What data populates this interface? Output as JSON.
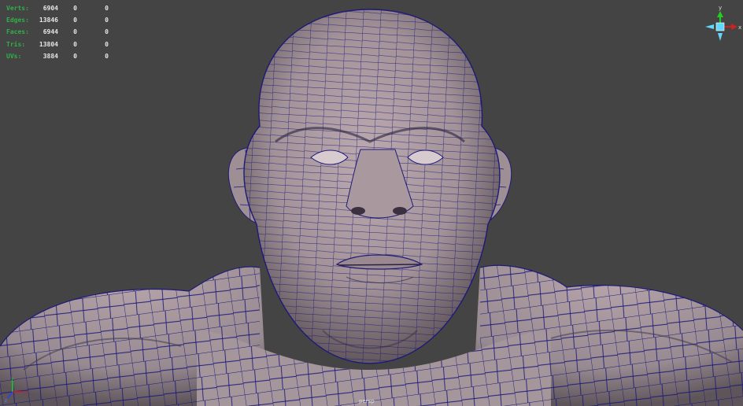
{
  "viewport": {
    "background": "#444444",
    "mesh_fill": "#9c8c92",
    "wire_color": "#1e1a78"
  },
  "hud": {
    "rows": [
      {
        "label": "Verts:",
        "v1": "6904",
        "v2": "0",
        "v3": "0"
      },
      {
        "label": "Edges:",
        "v1": "13846",
        "v2": "0",
        "v3": "0"
      },
      {
        "label": "Faces:",
        "v1": "6944",
        "v2": "0",
        "v3": "0"
      },
      {
        "label": "Tris:",
        "v1": "13804",
        "v2": "0",
        "v3": "0"
      },
      {
        "label": "UVs:",
        "v1": "3884",
        "v2": "0",
        "v3": "0"
      }
    ]
  },
  "gizmo": {
    "axis_y": "y",
    "axis_x": "x",
    "axis_z": "z",
    "colors": {
      "y": "#22cc22",
      "x": "#cc2222",
      "z": "#2244ee",
      "cube": "#5fd7ff"
    }
  },
  "bottom": {
    "label": "persp"
  }
}
